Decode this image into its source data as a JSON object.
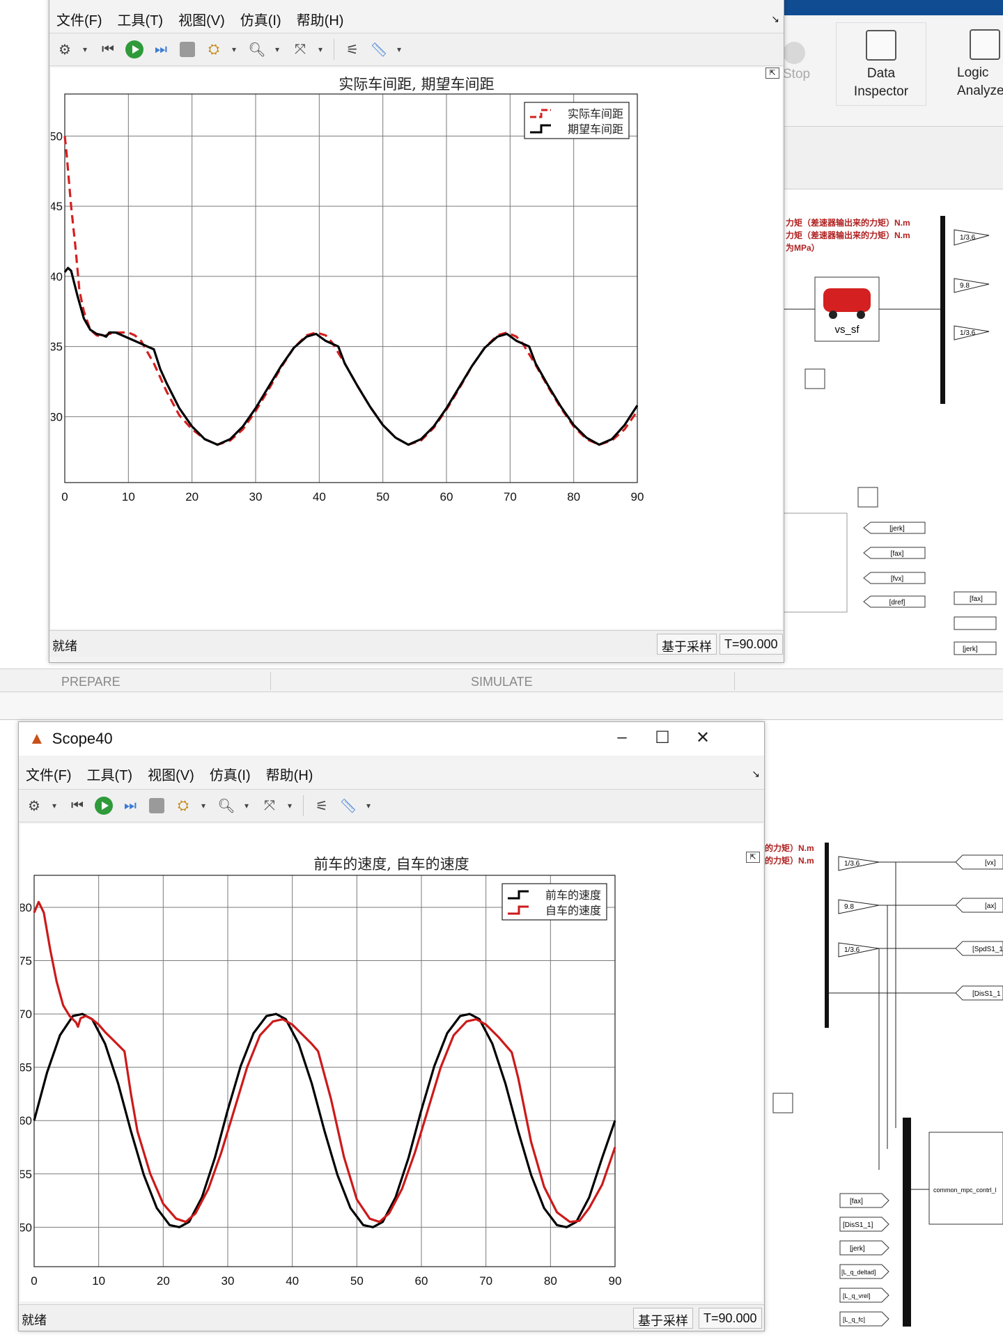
{
  "background": {
    "ribbon": {
      "stop_label": "Stop",
      "data_inspector_label": "Data\nInspector",
      "logic_analyzer_label": "Logic\nAnalyzer"
    },
    "sections": [
      "PREPARE",
      "SIMULATE"
    ],
    "vehicle_block_label": "vs_sf",
    "annotations_top": [
      "力矩（差速器输出来的力矩）N.m",
      "力矩（差速器输出来的力矩）N.m",
      "为MPa）"
    ],
    "annotations_bottom": [
      "的力矩）N.m",
      "的力矩）N.m"
    ],
    "gain_labels": [
      "1/3.6",
      "9.8",
      "1/3.6"
    ],
    "goto_tags_top": [
      "[jerk]",
      "[fax]",
      "[fvx]",
      "[dref]"
    ],
    "goto_tags_bottom": [
      "[vx]",
      "[ax]",
      "[SpdS1_1",
      "[DisS1_1"
    ],
    "from_tags_bottom": [
      "[fax]",
      "[DisS1_1]",
      "[jerk]",
      "[L_q_deltad]",
      "[L_q_vrel]",
      "[L_q_fc]"
    ],
    "mpc_block_label": "common_mpc_contrl_l"
  },
  "scope_top": {
    "menu": [
      "文件(F)",
      "工具(T)",
      "视图(V)",
      "仿真(I)",
      "帮助(H)"
    ],
    "status": "就绪",
    "mode": "基于采样",
    "time": "T=90.000",
    "chart_title": "实际车间距, 期望车间距"
  },
  "scope_bottom": {
    "window_title": "Scope40",
    "menu": [
      "文件(F)",
      "工具(T)",
      "视图(V)",
      "仿真(I)",
      "帮助(H)"
    ],
    "status": "就绪",
    "mode": "基于采样",
    "time": "T=90.000",
    "chart_title": "前车的速度, 自车的速度"
  },
  "chart_data": [
    {
      "type": "line",
      "title": "实际车间距, 期望车间距",
      "xlim": [
        0,
        90
      ],
      "ylim": [
        25.3,
        53
      ],
      "xticks": [
        0,
        10,
        20,
        30,
        40,
        50,
        60,
        70,
        80,
        90
      ],
      "yticks": [
        30,
        35,
        40,
        45,
        50
      ],
      "grid": true,
      "legend": "top-right",
      "series": [
        {
          "name": "实际车间距",
          "color": "#d42020",
          "dash": true,
          "points": [
            [
              0,
              50
            ],
            [
              0.3,
              48.7
            ],
            [
              1,
              45
            ],
            [
              1.7,
              42
            ],
            [
              2.3,
              39
            ],
            [
              3,
              37.5
            ],
            [
              4,
              36.2
            ],
            [
              5,
              35.8
            ],
            [
              6,
              35.7
            ],
            [
              7,
              35.9
            ],
            [
              8,
              36.0
            ],
            [
              9,
              36.0
            ],
            [
              10,
              36.0
            ],
            [
              11,
              35.8
            ],
            [
              12,
              35.4
            ],
            [
              13,
              34.6
            ],
            [
              14,
              33.8
            ],
            [
              15,
              32.8
            ],
            [
              16,
              31.8
            ],
            [
              18,
              30.1
            ],
            [
              20,
              29.1
            ],
            [
              22,
              28.4
            ],
            [
              24,
              28.0
            ],
            [
              26,
              28.3
            ],
            [
              28,
              29.1
            ],
            [
              30,
              30.4
            ],
            [
              32,
              31.9
            ],
            [
              34,
              33.5
            ],
            [
              36,
              34.9
            ],
            [
              38,
              35.8
            ],
            [
              39.5,
              36.0
            ],
            [
              41,
              35.8
            ],
            [
              42,
              35.3
            ],
            [
              44,
              33.8
            ],
            [
              46,
              32.2
            ],
            [
              48,
              30.7
            ],
            [
              50,
              29.4
            ],
            [
              52,
              28.5
            ],
            [
              54,
              28.0
            ],
            [
              56,
              28.3
            ],
            [
              58,
              29.2
            ],
            [
              60,
              30.5
            ],
            [
              62,
              32.0
            ],
            [
              64,
              33.6
            ],
            [
              66,
              34.9
            ],
            [
              68,
              35.8
            ],
            [
              69.5,
              36.0
            ],
            [
              71,
              35.7
            ],
            [
              72,
              35.2
            ],
            [
              74,
              33.7
            ],
            [
              76,
              32.1
            ],
            [
              78,
              30.6
            ],
            [
              80,
              29.3
            ],
            [
              82,
              28.4
            ],
            [
              84,
              28.0
            ],
            [
              86,
              28.3
            ],
            [
              88,
              29.1
            ],
            [
              90,
              30.4
            ]
          ]
        },
        {
          "name": "期望车间距",
          "color": "#000000",
          "dash": false,
          "points": [
            [
              0,
              40.3
            ],
            [
              0.5,
              40.6
            ],
            [
              1,
              40.4
            ],
            [
              2,
              38.6
            ],
            [
              3,
              37.0
            ],
            [
              4,
              36.2
            ],
            [
              5,
              35.9
            ],
            [
              6,
              35.8
            ],
            [
              6.5,
              35.7
            ],
            [
              7,
              36.0
            ],
            [
              8,
              36.0
            ],
            [
              9,
              35.8
            ],
            [
              10,
              35.6
            ],
            [
              11,
              35.4
            ],
            [
              12,
              35.2
            ],
            [
              13,
              35.0
            ],
            [
              14,
              34.8
            ],
            [
              15,
              33.4
            ],
            [
              16,
              32.4
            ],
            [
              18,
              30.6
            ],
            [
              20,
              29.3
            ],
            [
              22,
              28.4
            ],
            [
              24,
              28.0
            ],
            [
              26,
              28.4
            ],
            [
              28,
              29.3
            ],
            [
              30,
              30.6
            ],
            [
              32,
              32.1
            ],
            [
              34,
              33.6
            ],
            [
              36,
              34.9
            ],
            [
              38,
              35.7
            ],
            [
              39.5,
              35.9
            ],
            [
              41,
              35.4
            ],
            [
              43,
              35.0
            ],
            [
              44,
              33.8
            ],
            [
              46,
              32.2
            ],
            [
              48,
              30.7
            ],
            [
              50,
              29.4
            ],
            [
              52,
              28.5
            ],
            [
              54,
              28.0
            ],
            [
              56,
              28.4
            ],
            [
              58,
              29.3
            ],
            [
              60,
              30.6
            ],
            [
              62,
              32.1
            ],
            [
              64,
              33.6
            ],
            [
              66,
              34.9
            ],
            [
              68,
              35.7
            ],
            [
              69.5,
              35.9
            ],
            [
              71,
              35.4
            ],
            [
              73,
              35.0
            ],
            [
              74,
              33.8
            ],
            [
              76,
              32.2
            ],
            [
              78,
              30.7
            ],
            [
              80,
              29.4
            ],
            [
              82,
              28.5
            ],
            [
              84,
              28.0
            ],
            [
              86,
              28.4
            ],
            [
              88,
              29.4
            ],
            [
              90,
              30.8
            ]
          ]
        }
      ]
    },
    {
      "type": "line",
      "title": "前车的速度, 自车的速度",
      "xlim": [
        0,
        90
      ],
      "ylim": [
        46.3,
        83
      ],
      "xticks": [
        0,
        10,
        20,
        30,
        40,
        50,
        60,
        70,
        80,
        90
      ],
      "yticks": [
        50,
        55,
        60,
        65,
        70,
        75,
        80
      ],
      "grid": true,
      "legend": "top-right",
      "series": [
        {
          "name": "前车的速度",
          "color": "#000000",
          "dash": false,
          "points": [
            [
              0,
              60
            ],
            [
              2,
              64.5
            ],
            [
              4,
              68.0
            ],
            [
              6,
              69.8
            ],
            [
              7.5,
              70.0
            ],
            [
              9,
              69.5
            ],
            [
              11,
              67.2
            ],
            [
              13,
              63.5
            ],
            [
              15,
              59.0
            ],
            [
              17,
              54.9
            ],
            [
              19,
              51.8
            ],
            [
              21,
              50.2
            ],
            [
              22.5,
              50.0
            ],
            [
              24,
              50.5
            ],
            [
              26,
              52.8
            ],
            [
              28,
              56.5
            ],
            [
              30,
              61.0
            ],
            [
              32,
              65.1
            ],
            [
              34,
              68.2
            ],
            [
              36,
              69.8
            ],
            [
              37.5,
              70.0
            ],
            [
              39,
              69.5
            ],
            [
              41,
              67.2
            ],
            [
              43,
              63.5
            ],
            [
              45,
              59.0
            ],
            [
              47,
              54.9
            ],
            [
              49,
              51.8
            ],
            [
              51,
              50.2
            ],
            [
              52.5,
              50.0
            ],
            [
              54,
              50.5
            ],
            [
              56,
              52.8
            ],
            [
              58,
              56.5
            ],
            [
              60,
              61.0
            ],
            [
              62,
              65.1
            ],
            [
              64,
              68.2
            ],
            [
              66,
              69.8
            ],
            [
              67.5,
              70.0
            ],
            [
              69,
              69.5
            ],
            [
              71,
              67.2
            ],
            [
              73,
              63.5
            ],
            [
              75,
              59.0
            ],
            [
              77,
              54.9
            ],
            [
              79,
              51.8
            ],
            [
              81,
              50.2
            ],
            [
              82.5,
              50.0
            ],
            [
              84,
              50.5
            ],
            [
              86,
              52.8
            ],
            [
              88,
              56.5
            ],
            [
              90,
              60.0
            ]
          ]
        },
        {
          "name": "自车的速度",
          "color": "#cc1a1a",
          "dash": false,
          "points": [
            [
              0,
              79.5
            ],
            [
              0.7,
              80.5
            ],
            [
              1.5,
              79.5
            ],
            [
              2.5,
              76.0
            ],
            [
              3.5,
              73.0
            ],
            [
              4.5,
              70.8
            ],
            [
              5.5,
              69.8
            ],
            [
              6.5,
              69.2
            ],
            [
              6.8,
              68.8
            ],
            [
              7.2,
              69.6
            ],
            [
              8,
              69.8
            ],
            [
              9,
              69.5
            ],
            [
              10,
              69.0
            ],
            [
              11,
              68.3
            ],
            [
              12,
              67.7
            ],
            [
              13,
              67.1
            ],
            [
              14,
              66.5
            ],
            [
              15,
              62.5
            ],
            [
              16,
              59.0
            ],
            [
              18,
              55.0
            ],
            [
              20,
              52.2
            ],
            [
              22,
              50.8
            ],
            [
              23.5,
              50.5
            ],
            [
              25,
              51.3
            ],
            [
              27,
              53.6
            ],
            [
              29,
              57.0
            ],
            [
              31,
              61.0
            ],
            [
              33,
              65.0
            ],
            [
              35,
              68.0
            ],
            [
              37,
              69.3
            ],
            [
              38.5,
              69.5
            ],
            [
              40,
              69.0
            ],
            [
              42,
              67.8
            ],
            [
              43,
              67.2
            ],
            [
              44,
              66.5
            ],
            [
              46,
              62.0
            ],
            [
              48,
              56.6
            ],
            [
              50,
              52.6
            ],
            [
              52,
              50.8
            ],
            [
              53.5,
              50.5
            ],
            [
              55,
              51.3
            ],
            [
              57,
              53.6
            ],
            [
              59,
              57.0
            ],
            [
              61,
              61.0
            ],
            [
              63,
              65.0
            ],
            [
              65,
              68.0
            ],
            [
              67,
              69.3
            ],
            [
              68.5,
              69.5
            ],
            [
              70,
              69.0
            ],
            [
              72,
              67.8
            ],
            [
              74,
              66.4
            ],
            [
              75,
              64.0
            ],
            [
              77,
              58.0
            ],
            [
              79,
              53.8
            ],
            [
              81,
              51.4
            ],
            [
              83,
              50.5
            ],
            [
              84.5,
              50.6
            ],
            [
              86,
              51.8
            ],
            [
              88,
              54.0
            ],
            [
              90,
              57.5
            ]
          ]
        }
      ]
    }
  ]
}
